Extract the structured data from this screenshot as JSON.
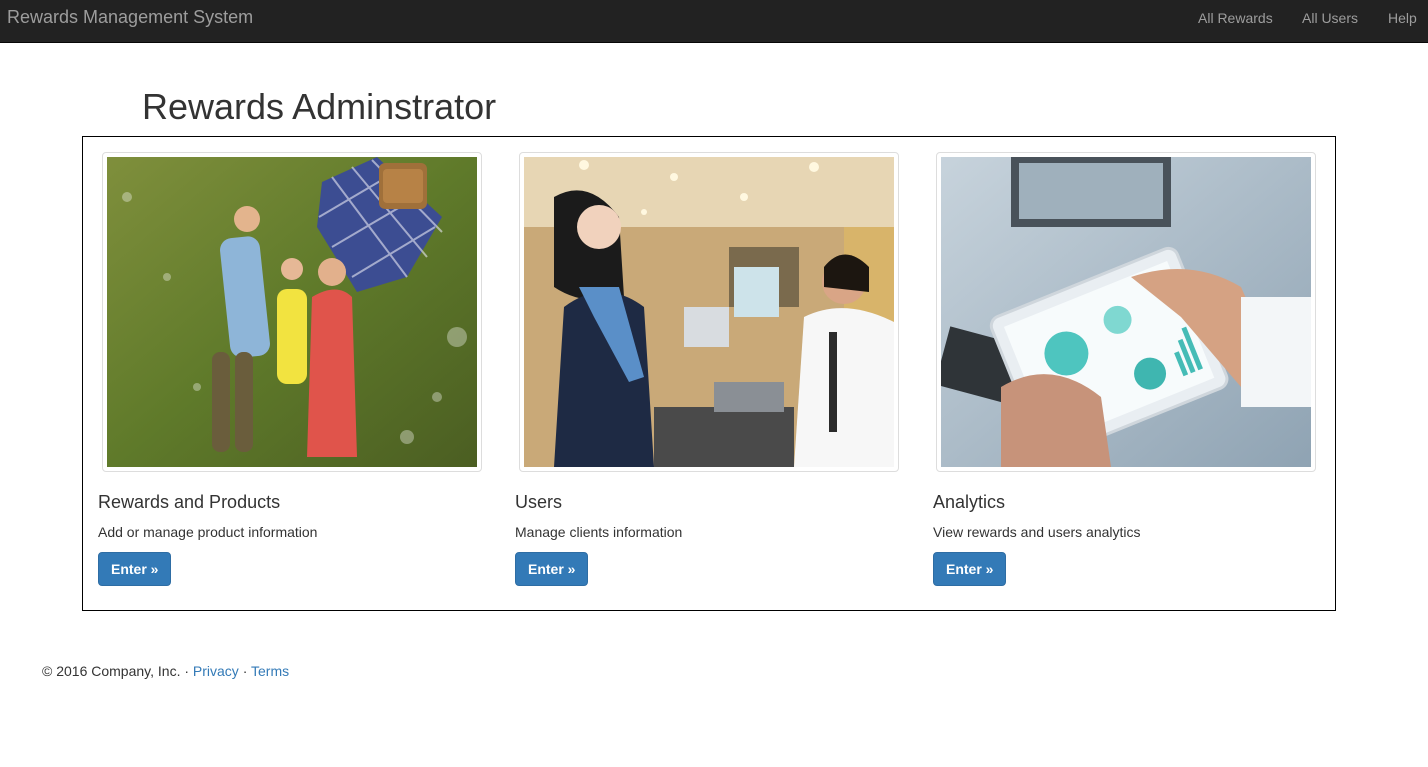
{
  "navbar": {
    "brand": "Rewards Management System",
    "links": [
      "All Rewards",
      "All Users",
      "Help"
    ]
  },
  "page": {
    "title": "Rewards Adminstrator"
  },
  "cards": [
    {
      "title": "Rewards and Products",
      "description": "Add or manage product information",
      "button": "Enter »",
      "image": "family-picnic-photo"
    },
    {
      "title": "Users",
      "description": "Manage clients information",
      "button": "Enter »",
      "image": "store-checkout-photo"
    },
    {
      "title": "Analytics",
      "description": "View rewards and users analytics",
      "button": "Enter »",
      "image": "tablet-analytics-photo"
    }
  ],
  "footer": {
    "copyright": "© 2016 Company, Inc. · ",
    "sep": " · ",
    "privacy": "Privacy",
    "terms": "Terms"
  },
  "colors": {
    "navbar_bg": "#222222",
    "link_muted": "#9d9d9d",
    "primary": "#337ab7",
    "link": "#337ab7"
  }
}
